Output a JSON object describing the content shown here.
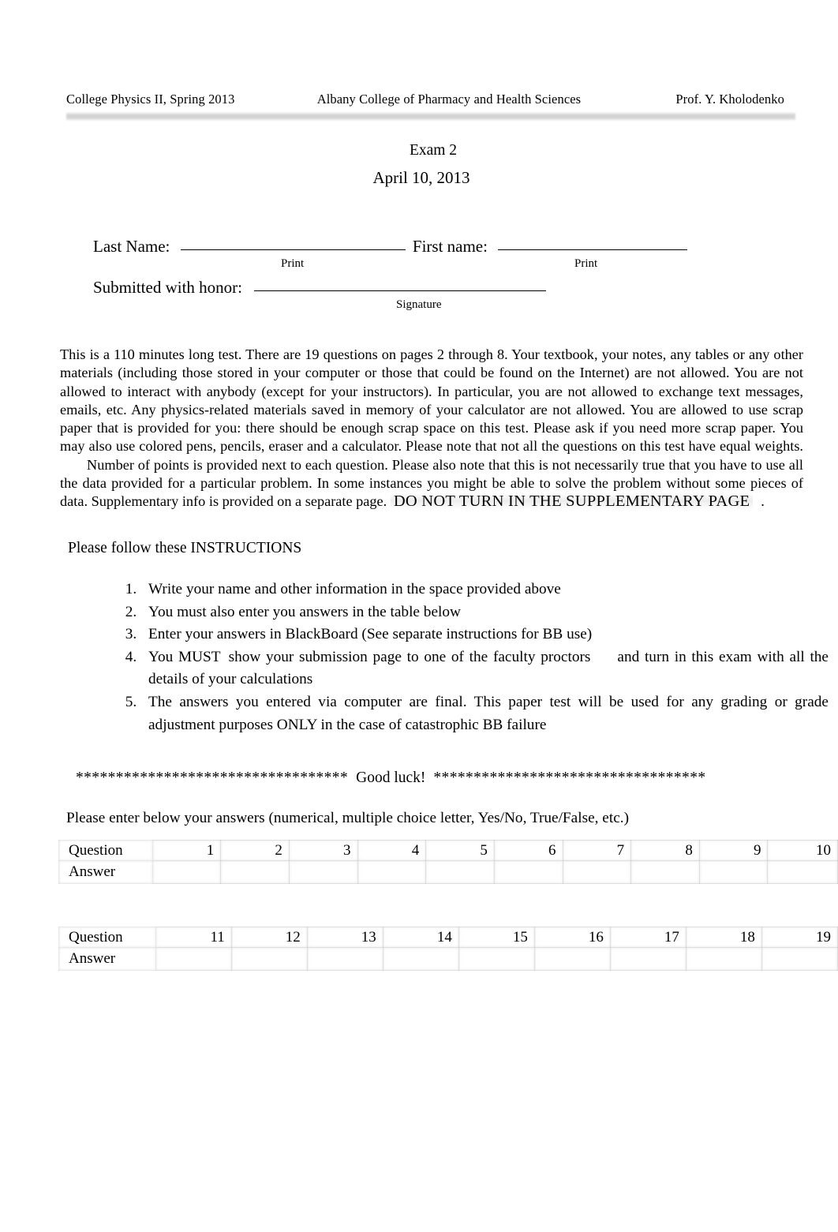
{
  "header": {
    "left": "College Physics II, Spring 2013",
    "middle": "Albany College of Pharmacy and Health Sciences",
    "right": "Prof. Y. Kholodenko"
  },
  "title": {
    "exam": "Exam 2",
    "date": "April 10, 2013"
  },
  "fields": {
    "last_name_label": "Last Name:",
    "first_name_label": "First name:",
    "submitted_label": "Submitted with honor:",
    "caption_print_1": "Print",
    "caption_print_2": "Print",
    "caption_signature": "Signature",
    "last_name_value": "",
    "first_name_value": "",
    "signature_value": ""
  },
  "intro": {
    "part1": "This is a 110 minutes long test. There are 19 questions on pages 2 through 8. Your textbook, your notes, any tables or any other materials (including those stored in your computer or those that could be found on the Internet) are not allowed",
    "part2": ". You are not allowed  to interact with anybody (except for your instructors). In particular, you are  not allowed to exchange text messages, emails, etc. Any physics-related materials saved in memory of your calculator are  not allowed.  You are allowed to use scrap paper that is provided for you: there should be enough scrap space on this test. Please ask if you need more scrap paper. You may also use colored pens, pencils, eraser and a calculator.   Please note that not all the questions on this test have equal weights.",
    "part3": "Number of points is provided next to each question. Please also note that this is not necessarily true that you have to use all the data provided for a particular problem. In some instances you might be able to solve the problem without some pieces of data",
    "part4": ". Supplementary info is provided on a separate page.",
    "emphasis": "DO NOT TURN IN THE SUPPLEMENTARY PAGE",
    "part5": "."
  },
  "instructions": {
    "heading": "Please follow these INSTRUCTIONS",
    "items": [
      "Write your name and other information in the space provided above",
      "You must also enter you answers in the table below",
      "Enter your answers in BlackBoard (See separate instructions for BB use)",
      "You MUST   show your submission page to one of the faculty proctors      and turn in this exam with all the details of your calculations",
      "The answers you entered via computer are final. This paper test will be used for any grading or grade adjustment purposes ONLY in the case of catastrophic BB failure"
    ],
    "item4_a": "You MUST",
    "item4_b": "show your submission page to one of the faculty proctors",
    "item4_c": "and turn in this exam with all the details of your calculations"
  },
  "goodluck": {
    "stars_left": "**********************************",
    "text": "Good luck!",
    "stars_right": "**********************************"
  },
  "answers_lead": "Please enter below your answers (numerical, multiple choice letter, Yes/No, True/False, etc.)",
  "answer_tables": [
    {
      "question_label": "Question",
      "answer_label": "Answer",
      "questions": [
        "1",
        "2",
        "3",
        "4",
        "5",
        "6",
        "7",
        "8",
        "9",
        "10"
      ],
      "answers": [
        "",
        "",
        "",
        "",
        "",
        "",
        "",
        "",
        "",
        ""
      ]
    },
    {
      "question_label": "Question",
      "answer_label": "Answer",
      "questions": [
        "11",
        "12",
        "13",
        "14",
        "15",
        "16",
        "17",
        "18",
        "19"
      ],
      "answers": [
        "",
        "",
        "",
        "",
        "",
        "",
        "",
        "",
        ""
      ]
    }
  ],
  "colors": {
    "text": "#000000",
    "page": "#ffffff",
    "rule": "#cdcdcd",
    "table_border": "#96969650"
  }
}
